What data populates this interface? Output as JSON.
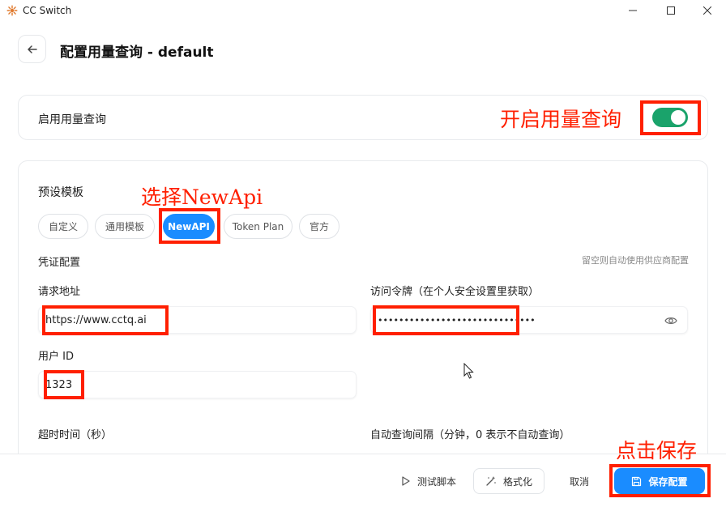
{
  "window": {
    "title": "CC Switch",
    "controls": [
      "minimize",
      "maximize",
      "close"
    ]
  },
  "header": {
    "title": "配置用量查询 - default"
  },
  "toggle_card": {
    "label": "启用用量查询",
    "enabled": true
  },
  "templates": {
    "title": "预设模板",
    "chips": [
      "自定义",
      "通用模板",
      "NewAPI",
      "Token Plan",
      "官方"
    ],
    "selected": "NewAPI"
  },
  "credentials": {
    "title": "凭证配置",
    "hint": "留空则自动使用供应商配置",
    "request_url_label": "请求地址",
    "request_url_value": "https://www.cctq.ai",
    "token_label": "访问令牌（在个人安全设置里获取）",
    "token_value": "••••••••••••••••••••••••••••••",
    "user_id_label": "用户 ID",
    "user_id_value": "1323"
  },
  "timing": {
    "timeout_label": "超时时间（秒）",
    "interval_label": "自动查询间隔（分钟，0 表示不自动查询）"
  },
  "footer": {
    "test_label": "测试脚本",
    "format_label": "格式化",
    "cancel_label": "取消",
    "save_label": "保存配置"
  },
  "annotations": {
    "toggle_note": "开启用量查询",
    "select_note": "选择NewApi",
    "save_note": "点击保存"
  },
  "colors": {
    "accent": "#1a8cff",
    "toggle_on": "#1aa36b",
    "annotation": "#ff1f00"
  }
}
